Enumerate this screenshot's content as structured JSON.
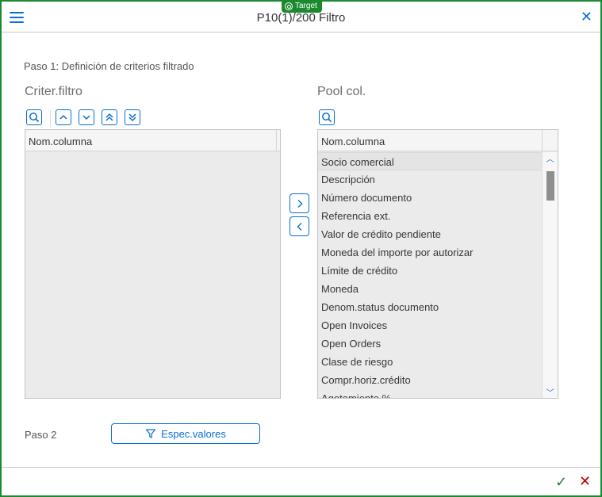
{
  "window": {
    "title": "P10(1)/200 Filtro",
    "target_badge": "Target"
  },
  "step1": {
    "label": "Paso 1: Definición de criterios filtrado"
  },
  "left_panel": {
    "title": "Criter.filtro",
    "column_header": "Nom.columna",
    "rows": []
  },
  "right_panel": {
    "title": "Pool col.",
    "column_header": "Nom.columna",
    "rows": [
      "Socio comercial",
      "Descripción",
      "Número documento",
      "Referencia ext.",
      "Valor de crédito pendiente",
      "Moneda del importe por autorizar",
      "Límite de crédito",
      "Moneda",
      "Denom.status documento",
      "Open Invoices",
      "Open Orders",
      "Clase de riesgo",
      "Compr.horiz.crédito",
      "Agotamiento %"
    ]
  },
  "step2": {
    "label": "Paso 2",
    "button_label": "Espec.valores"
  },
  "colors": {
    "accent": "#0a6ed1",
    "frame": "#1b8a2e",
    "ok": "#2b7d2b",
    "cancel": "#bb0000"
  }
}
